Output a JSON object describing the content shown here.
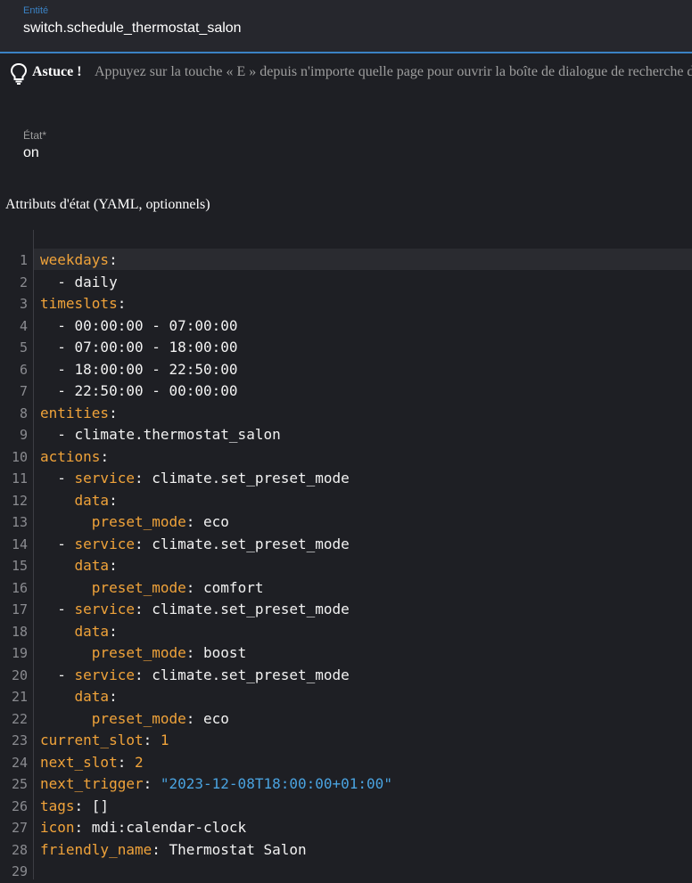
{
  "entity_field": {
    "label": "Entité",
    "value": "switch.schedule_thermostat_salon"
  },
  "tip": {
    "icon": "lightbulb-icon",
    "bold": "Astuce !",
    "text": "Appuyez sur la touche « E » depuis n'importe quelle page pour ouvrir la boîte de dialogue de recherche d'entités"
  },
  "state_field": {
    "label": "État*",
    "value": "on"
  },
  "attributes_label": "Attributs d'état (YAML, optionnels)",
  "colors": {
    "accent": "#3b82c4",
    "key": "#f0a33a",
    "string": "#4aa3e0",
    "background": "#1e1f24"
  },
  "editor": {
    "lines": [
      [
        {
          "t": "weekdays",
          "c": "k"
        },
        {
          "t": ":",
          "c": "p"
        }
      ],
      [
        {
          "t": "  - daily",
          "c": "p"
        }
      ],
      [
        {
          "t": "timeslots",
          "c": "k"
        },
        {
          "t": ":",
          "c": "p"
        }
      ],
      [
        {
          "t": "  - 00:00:00 - 07:00:00",
          "c": "p"
        }
      ],
      [
        {
          "t": "  - 07:00:00 - 18:00:00",
          "c": "p"
        }
      ],
      [
        {
          "t": "  - 18:00:00 - 22:50:00",
          "c": "p"
        }
      ],
      [
        {
          "t": "  - 22:50:00 - 00:00:00",
          "c": "p"
        }
      ],
      [
        {
          "t": "entities",
          "c": "k"
        },
        {
          "t": ":",
          "c": "p"
        }
      ],
      [
        {
          "t": "  - climate.thermostat_salon",
          "c": "p"
        }
      ],
      [
        {
          "t": "actions",
          "c": "k"
        },
        {
          "t": ":",
          "c": "p"
        }
      ],
      [
        {
          "t": "  - ",
          "c": "p"
        },
        {
          "t": "service",
          "c": "k"
        },
        {
          "t": ": climate.set_preset_mode",
          "c": "p"
        }
      ],
      [
        {
          "t": "    ",
          "c": "p"
        },
        {
          "t": "data",
          "c": "k"
        },
        {
          "t": ":",
          "c": "p"
        }
      ],
      [
        {
          "t": "      ",
          "c": "p"
        },
        {
          "t": "preset_mode",
          "c": "k"
        },
        {
          "t": ": eco",
          "c": "p"
        }
      ],
      [
        {
          "t": "  - ",
          "c": "p"
        },
        {
          "t": "service",
          "c": "k"
        },
        {
          "t": ": climate.set_preset_mode",
          "c": "p"
        }
      ],
      [
        {
          "t": "    ",
          "c": "p"
        },
        {
          "t": "data",
          "c": "k"
        },
        {
          "t": ":",
          "c": "p"
        }
      ],
      [
        {
          "t": "      ",
          "c": "p"
        },
        {
          "t": "preset_mode",
          "c": "k"
        },
        {
          "t": ": comfort",
          "c": "p"
        }
      ],
      [
        {
          "t": "  - ",
          "c": "p"
        },
        {
          "t": "service",
          "c": "k"
        },
        {
          "t": ": climate.set_preset_mode",
          "c": "p"
        }
      ],
      [
        {
          "t": "    ",
          "c": "p"
        },
        {
          "t": "data",
          "c": "k"
        },
        {
          "t": ":",
          "c": "p"
        }
      ],
      [
        {
          "t": "      ",
          "c": "p"
        },
        {
          "t": "preset_mode",
          "c": "k"
        },
        {
          "t": ": boost",
          "c": "p"
        }
      ],
      [
        {
          "t": "  - ",
          "c": "p"
        },
        {
          "t": "service",
          "c": "k"
        },
        {
          "t": ": climate.set_preset_mode",
          "c": "p"
        }
      ],
      [
        {
          "t": "    ",
          "c": "p"
        },
        {
          "t": "data",
          "c": "k"
        },
        {
          "t": ":",
          "c": "p"
        }
      ],
      [
        {
          "t": "      ",
          "c": "p"
        },
        {
          "t": "preset_mode",
          "c": "k"
        },
        {
          "t": ": eco",
          "c": "p"
        }
      ],
      [
        {
          "t": "current_slot",
          "c": "k"
        },
        {
          "t": ": ",
          "c": "p"
        },
        {
          "t": "1",
          "c": "n"
        }
      ],
      [
        {
          "t": "next_slot",
          "c": "k"
        },
        {
          "t": ": ",
          "c": "p"
        },
        {
          "t": "2",
          "c": "n"
        }
      ],
      [
        {
          "t": "next_trigger",
          "c": "k"
        },
        {
          "t": ": ",
          "c": "p"
        },
        {
          "t": "\"2023-12-08T18:00:00+01:00\"",
          "c": "s"
        }
      ],
      [
        {
          "t": "tags",
          "c": "k"
        },
        {
          "t": ": []",
          "c": "p"
        }
      ],
      [
        {
          "t": "icon",
          "c": "k"
        },
        {
          "t": ": mdi:calendar-clock",
          "c": "p"
        }
      ],
      [
        {
          "t": "friendly_name",
          "c": "k"
        },
        {
          "t": ": Thermostat Salon",
          "c": "p"
        }
      ],
      []
    ]
  }
}
